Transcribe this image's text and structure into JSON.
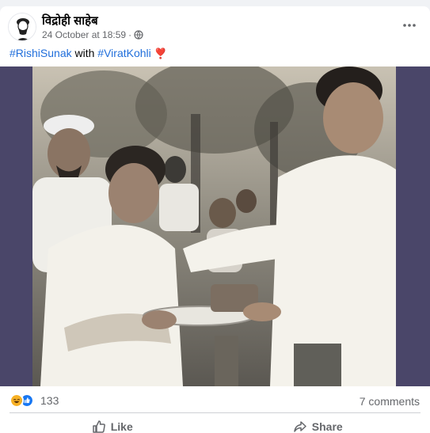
{
  "post": {
    "author": "विद्रोही साहेब",
    "timestamp": "24 October at 18:59",
    "separator": "·",
    "privacy_icon": "globe-icon",
    "more_icon": "more-horizontal-icon",
    "caption": {
      "hashtag1": "#RishiSunak",
      "connector": " with ",
      "hashtag2": "#ViratKohli",
      "emoji": "❣️"
    },
    "photo_icon": "photo-image"
  },
  "stats": {
    "reaction_icons": [
      "haha-reaction-icon",
      "like-reaction-icon"
    ],
    "reaction_count": "133",
    "comments": "7 comments"
  },
  "actions": {
    "like_label": "Like",
    "like_icon": "thumbs-up-icon",
    "share_label": "Share",
    "share_icon": "share-arrow-icon"
  },
  "colors": {
    "hashtag": "#216fdb",
    "secondary_text": "#65676b",
    "media_background": "#4a4669",
    "like_blue": "#1877f2",
    "haha_yellow": "#f7b125"
  }
}
